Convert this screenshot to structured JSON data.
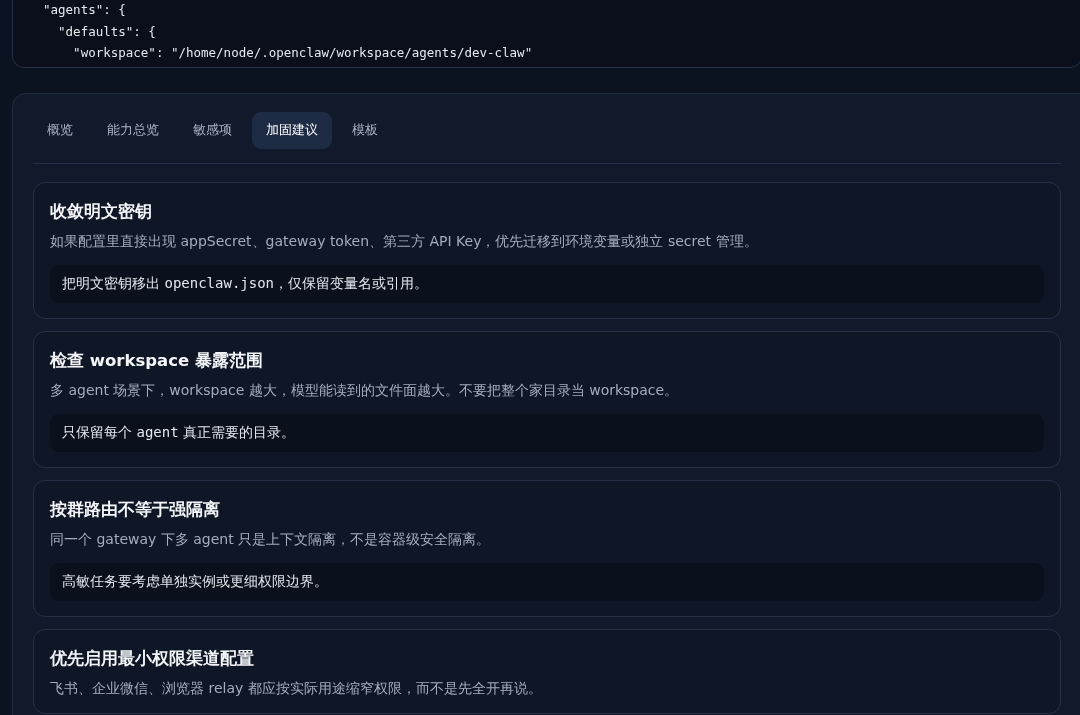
{
  "config_code": {
    "lines": [
      "\"agents\": {",
      "  \"defaults\": {",
      "    \"workspace\": \"/home/node/.openclaw/workspace/agents/dev-claw\""
    ]
  },
  "tabs": [
    {
      "label": "概览",
      "selected": false
    },
    {
      "label": "能力总览",
      "selected": false
    },
    {
      "label": "敏感项",
      "selected": false
    },
    {
      "label": "加固建议",
      "selected": true
    },
    {
      "label": "模板",
      "selected": false
    }
  ],
  "cards": [
    {
      "title": "收敛明文密钥",
      "description": "如果配置里直接出现 appSecret、gateway token、第三方 API Key，优先迁移到环境变量或独立 secret 管理。",
      "tip": [
        {
          "kind": "text",
          "text": "把明文密钥移出 "
        },
        {
          "kind": "code",
          "text": "openclaw.json"
        },
        {
          "kind": "text",
          "text": "，仅保留变量名或引用。"
        }
      ]
    },
    {
      "title": "检查 workspace 暴露范围",
      "description": "多 agent 场景下，workspace 越大，模型能读到的文件面越大。不要把整个家目录当 workspace。",
      "tip": [
        {
          "kind": "text",
          "text": "只保留每个 "
        },
        {
          "kind": "code",
          "text": "agent"
        },
        {
          "kind": "text",
          "text": " 真正需要的目录。"
        }
      ]
    },
    {
      "title": "按群路由不等于强隔离",
      "description": "同一个 gateway 下多 agent 只是上下文隔离，不是容器级安全隔离。",
      "tip": [
        {
          "kind": "text",
          "text": "高敏任务要考虑单独实例或更细权限边界。"
        }
      ]
    },
    {
      "title": "优先启用最小权限渠道配置",
      "description": "飞书、企业微信、浏览器 relay 都应按实际用途缩窄权限，而不是先全开再说。"
    }
  ]
}
